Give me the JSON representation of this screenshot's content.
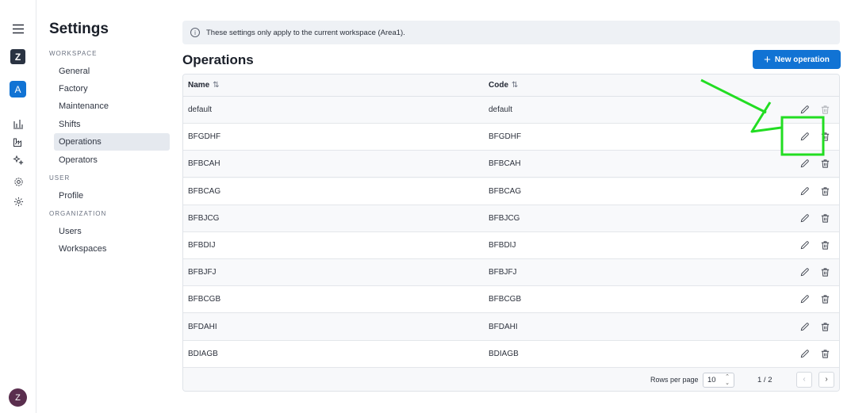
{
  "sidebar_rail": {
    "logo_letter": "Z",
    "workspace_letter": "A",
    "avatar_letter": "Z",
    "icons": [
      "menu-icon",
      "bar-chart-icon",
      "factory-icon",
      "sparkles-icon",
      "settings-gear-icon",
      "settings-cog-icon"
    ]
  },
  "settings_nav": {
    "title": "Settings",
    "sections": [
      {
        "label": "WORKSPACE",
        "items": [
          "General",
          "Factory",
          "Maintenance",
          "Shifts",
          "Operations",
          "Operators"
        ]
      },
      {
        "label": "USER",
        "items": [
          "Profile"
        ]
      },
      {
        "label": "ORGANIZATION",
        "items": [
          "Users",
          "Workspaces"
        ]
      }
    ],
    "active_item": "Operations"
  },
  "banner": {
    "text": "These settings only apply to the current workspace (Area1)."
  },
  "main": {
    "title": "Operations",
    "new_button_label": "New operation"
  },
  "table": {
    "columns": [
      "Name",
      "Code"
    ],
    "rows": [
      {
        "name": "default",
        "code": "default"
      },
      {
        "name": "BFGDHF",
        "code": "BFGDHF"
      },
      {
        "name": "BFBCAH",
        "code": "BFBCAH"
      },
      {
        "name": "BFBCAG",
        "code": "BFBCAG"
      },
      {
        "name": "BFBJCG",
        "code": "BFBJCG"
      },
      {
        "name": "BFBDIJ",
        "code": "BFBDIJ"
      },
      {
        "name": "BFBJFJ",
        "code": "BFBJFJ"
      },
      {
        "name": "BFBCGB",
        "code": "BFBCGB"
      },
      {
        "name": "BFDAHI",
        "code": "BFDAHI"
      },
      {
        "name": "BDIAGB",
        "code": "BDIAGB"
      }
    ],
    "footer": {
      "rows_per_page_label": "Rows per page",
      "rows_per_page_value": "10",
      "page_info": "1 / 2",
      "prev_icon": "chevron-left-icon",
      "next_icon": "chevron-right-icon"
    }
  },
  "colors": {
    "accent": "#1173d4",
    "annotation": "#22dd22"
  }
}
